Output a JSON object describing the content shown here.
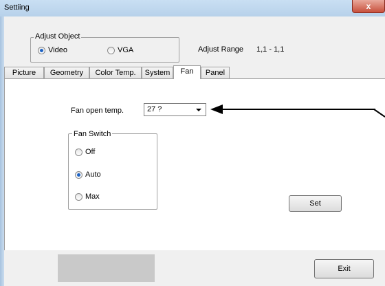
{
  "window": {
    "title": "Settiing",
    "close_glyph": "x"
  },
  "adjust_object": {
    "legend": "Adjust Object",
    "options": [
      {
        "label": "Video",
        "selected": true
      },
      {
        "label": "VGA",
        "selected": false
      }
    ]
  },
  "adjust_range": {
    "label": "Adjust Range",
    "value": "1,1 - 1,1"
  },
  "tabs": [
    {
      "label": "Picture",
      "active": false
    },
    {
      "label": "Geometry",
      "active": false
    },
    {
      "label": "Color Temp.",
      "active": false
    },
    {
      "label": "System",
      "active": false
    },
    {
      "label": "Fan",
      "active": true
    },
    {
      "label": "Panel",
      "active": false
    }
  ],
  "fan": {
    "open_temp_label": "Fan open temp.",
    "open_temp_value": "27 ?",
    "switch": {
      "legend": "Fan Switch",
      "options": [
        {
          "label": "Off",
          "selected": false
        },
        {
          "label": "Auto",
          "selected": true
        },
        {
          "label": "Max",
          "selected": false
        }
      ]
    },
    "set_label": "Set"
  },
  "footer": {
    "exit_label": "Exit"
  },
  "colors": {
    "selection": "#1e63c4",
    "close": "#c8503c"
  },
  "icons": [
    "close-icon",
    "chevron-down-icon",
    "arrow-left-icon"
  ]
}
